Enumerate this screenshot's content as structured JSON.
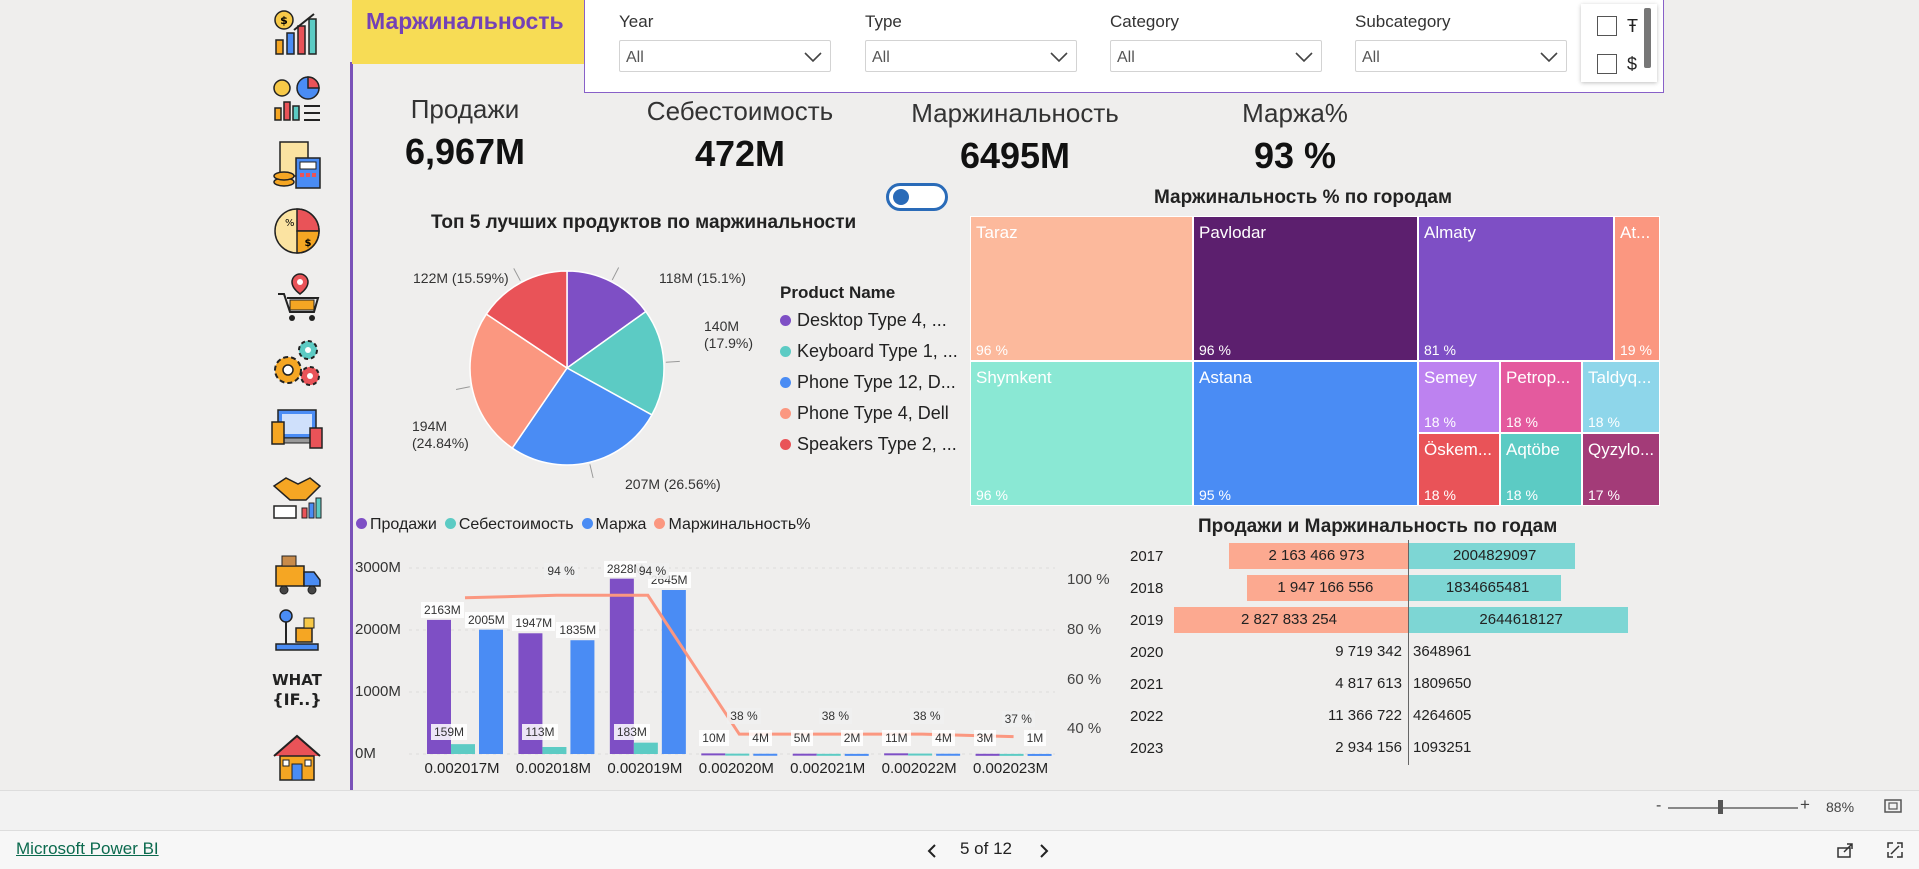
{
  "page_title": "Маржинальность",
  "slicers": [
    {
      "label": "Year",
      "value": "All"
    },
    {
      "label": "Type",
      "value": "All"
    },
    {
      "label": "Category",
      "value": "All"
    },
    {
      "label": "Subcategory",
      "value": "All"
    }
  ],
  "checklist": [
    {
      "label": "Ŧ"
    },
    {
      "label": "$"
    }
  ],
  "kpis": [
    {
      "label": "Продажи",
      "value": "6,967M"
    },
    {
      "label": "Себестоимость",
      "value": "472M"
    },
    {
      "label": "Маржинальность",
      "value": "6495M"
    },
    {
      "label": "Маржа%",
      "value": "93 %"
    }
  ],
  "sidebar_icons": [
    "sales-growth-icon",
    "sales-analytics-icon",
    "finance-calculator-icon",
    "pie-money-icon",
    "location-cart-icon",
    "gears-icon",
    "devices-icon",
    "handshake-chart-icon",
    "delivery-truck-icon",
    "warehouse-box-icon",
    "what-if-icon",
    "home-icon"
  ],
  "what_if_text": [
    "WHAT",
    "{IF..}"
  ],
  "colors": {
    "purple": "#7e4fc5",
    "teal": "#5ccbc4",
    "blue": "#4a8cf4",
    "salmon": "#fb9780",
    "red": "#e95358",
    "title_bg": "#f7dc55",
    "title_fg": "#7442b6"
  },
  "chart_data": [
    {
      "type": "pie",
      "title": "Топ 5 лучших продуктов по маржинальности",
      "legend_title": "Product Name",
      "legend_position": "right",
      "slices": [
        {
          "name": "Desktop Type 4, ...",
          "value": 118,
          "label": "118M (15.1%)",
          "color": "#7e4fc5"
        },
        {
          "name": "Keyboard Type 1, ...",
          "value": 140,
          "label": "140M (17.9%)",
          "color": "#5ccbc4"
        },
        {
          "name": "Phone Type 12, D...",
          "value": 207,
          "label": "207M (26.56%)",
          "color": "#4a8cf4"
        },
        {
          "name": "Phone Type 4, Dell",
          "value": 194,
          "label": "194M (24.84%)",
          "color": "#fb9780"
        },
        {
          "name": "Speakers Type 2, ...",
          "value": 122,
          "label": "122M (15.59%)",
          "color": "#e95358"
        }
      ]
    },
    {
      "type": "treemap",
      "title": "Маржинальность % по городам",
      "cells": [
        {
          "name": "Taraz",
          "value": "96 %",
          "color": "#fcb99c"
        },
        {
          "name": "Pavlodar",
          "value": "96 %",
          "color": "#5c1f6e"
        },
        {
          "name": "Almaty",
          "value": "81 %",
          "color": "#7e4fc5"
        },
        {
          "name": "At...",
          "value": "19 %",
          "color": "#fb9780"
        },
        {
          "name": "Shymkent",
          "value": "96 %",
          "color": "#8ae8d4"
        },
        {
          "name": "Astana",
          "value": "95 %",
          "color": "#4a8cf4"
        },
        {
          "name": "Semey",
          "value": "18 %",
          "color": "#bd82f0"
        },
        {
          "name": "Petrop...",
          "value": "18 %",
          "color": "#e45a9e"
        },
        {
          "name": "Taldyq...",
          "value": "18 %",
          "color": "#8ed6ea"
        },
        {
          "name": "Öskem...",
          "value": "18 %",
          "color": "#e95358"
        },
        {
          "name": "Aqtöbe",
          "value": "18 %",
          "color": "#5ccbc4"
        },
        {
          "name": "Qyzylo...",
          "value": "17 %",
          "color": "#a33b78"
        }
      ]
    },
    {
      "type": "bar",
      "title": "",
      "legend_position": "top-left",
      "legend": [
        "Продажи",
        "Себестоимость",
        "Маржа",
        "Маржинальность%"
      ],
      "categories": [
        "0.002017M",
        "0.002018M",
        "0.002019M",
        "0.002020M",
        "0.002021M",
        "0.002022M",
        "0.002023M"
      ],
      "ylim": [
        0,
        3000
      ],
      "yticks": [
        "0M",
        "1000M",
        "2000M",
        "3000M"
      ],
      "y2ticks": [
        "40 %",
        "60 %",
        "80 %",
        "100 %"
      ],
      "y2lim": [
        30,
        105
      ],
      "series": [
        {
          "name": "Продажи",
          "color": "#7e4fc5",
          "values": [
            2163,
            1947,
            2828,
            10,
            5,
            11,
            3
          ],
          "labels": [
            "2163M",
            "1947M",
            "2828M",
            "10M",
            "5M",
            "11M",
            "3M"
          ]
        },
        {
          "name": "Себестоимость",
          "color": "#5ccbc4",
          "values": [
            159,
            113,
            183,
            6,
            3,
            7,
            2
          ],
          "labels": [
            "159M",
            "113M",
            "183M",
            "",
            "",
            "",
            ""
          ]
        },
        {
          "name": "Маржа",
          "color": "#4a8cf4",
          "values": [
            2005,
            1835,
            2645,
            4,
            2,
            4,
            1
          ],
          "labels": [
            "2005M",
            "1835M",
            "2645M",
            "4M",
            "2M",
            "4M",
            "1M"
          ]
        },
        {
          "name": "Маржинальность%",
          "color": "#fb9780",
          "type": "line",
          "values": [
            93,
            94,
            94,
            38,
            38,
            38,
            37
          ],
          "labels": [
            "",
            "94 %",
            "94 %",
            "38 %",
            "38 %",
            "38 %",
            "37 %"
          ]
        }
      ]
    },
    {
      "type": "bar",
      "orientation": "horizontal-butterfly",
      "title": "Продажи и Маржинальность по годам",
      "categories": [
        "2017",
        "2018",
        "2019",
        "2020",
        "2021",
        "2022",
        "2023"
      ],
      "series": [
        {
          "name": "Продажи",
          "color": "#fca990",
          "values": [
            2163466973,
            1947166556,
            2827833254,
            9719342,
            4817613,
            11366722,
            2934156
          ],
          "labels": [
            "2 163 466 973",
            "1 947 166 556",
            "2 827 833 254",
            "9 719 342",
            "4 817 613",
            "11 366 722",
            "2 934 156"
          ]
        },
        {
          "name": "Маржинальность",
          "color": "#7dd6d4",
          "values": [
            2004829097,
            1834665481,
            2644618127,
            3648961,
            1809650,
            4264605,
            1093251
          ],
          "labels": [
            "2004829097",
            "1834665481",
            "2644618127",
            "3648961",
            "1809650",
            "4264605",
            "1093251"
          ]
        }
      ]
    }
  ],
  "footer": {
    "brand": "Microsoft Power BI",
    "page_indicator": "5 of 12",
    "zoom": "88%"
  }
}
